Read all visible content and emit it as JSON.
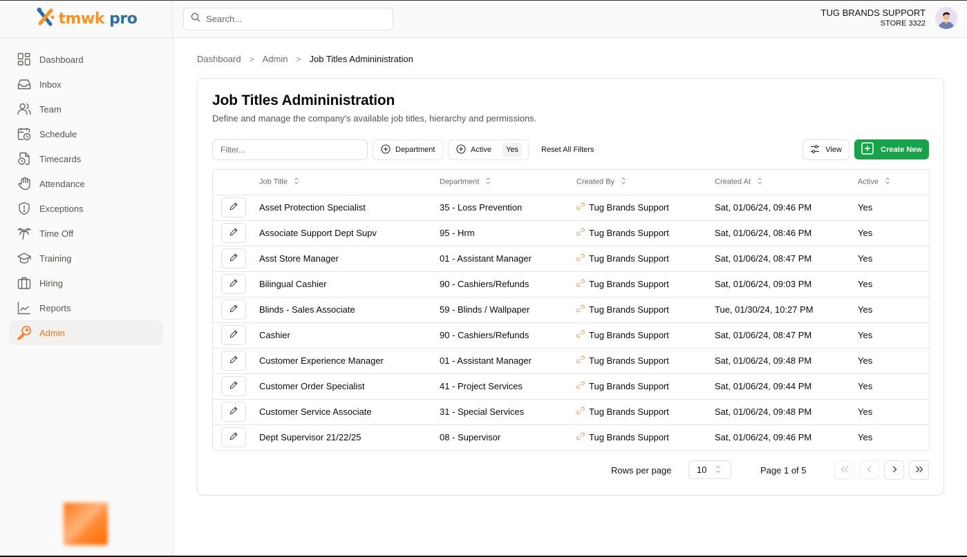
{
  "app": {
    "logo_prefix": "tmwk",
    "logo_suffix": "pro"
  },
  "header": {
    "search_placeholder": "Search...",
    "user_name": "TUG BRANDS SUPPORT",
    "user_store": "STORE 3322"
  },
  "sidebar": {
    "items": [
      {
        "label": "Dashboard",
        "icon": "dashboard-icon"
      },
      {
        "label": "Inbox",
        "icon": "inbox-icon"
      },
      {
        "label": "Team",
        "icon": "team-icon"
      },
      {
        "label": "Schedule",
        "icon": "schedule-icon"
      },
      {
        "label": "Timecards",
        "icon": "timecards-icon"
      },
      {
        "label": "Attendance",
        "icon": "attendance-icon"
      },
      {
        "label": "Exceptions",
        "icon": "exceptions-icon"
      },
      {
        "label": "Time Off",
        "icon": "time-off-icon"
      },
      {
        "label": "Training",
        "icon": "training-icon"
      },
      {
        "label": "Hiring",
        "icon": "hiring-icon"
      },
      {
        "label": "Reports",
        "icon": "reports-icon"
      },
      {
        "label": "Admin",
        "icon": "admin-key-icon",
        "active": true
      }
    ]
  },
  "breadcrumb": {
    "items": [
      "Dashboard",
      "Admin"
    ],
    "current": "Job Titles Admininistration"
  },
  "page": {
    "title": "Job Titles Admininistration",
    "subtitle": "Define and manage the company's available job titles, hierarchy and permissions."
  },
  "toolbar": {
    "filter_placeholder": "Filter...",
    "department_chip": "Department",
    "active_chip": "Active",
    "active_value": "Yes",
    "reset_label": "Reset All Filters",
    "view_label": "View",
    "create_label": "Create New"
  },
  "colors": {
    "accent": "#f97316",
    "primary_button": "#16a34a",
    "link_icon": "#f59e5b"
  },
  "table": {
    "columns": [
      "Job Title",
      "Department",
      "Created By",
      "Created At",
      "Active"
    ],
    "rows": [
      {
        "job_title": "Asset Protection Specialist",
        "department": "35 - Loss Prevention",
        "created_by": "Tug Brands Support",
        "created_at": "Sat, 01/06/24, 09:46 PM",
        "active": "Yes"
      },
      {
        "job_title": "Associate Support Dept Supv",
        "department": "95 - Hrm",
        "created_by": "Tug Brands Support",
        "created_at": "Sat, 01/06/24, 08:46 PM",
        "active": "Yes"
      },
      {
        "job_title": "Asst Store Manager",
        "department": "01 - Assistant Manager",
        "created_by": "Tug Brands Support",
        "created_at": "Sat, 01/06/24, 08:47 PM",
        "active": "Yes"
      },
      {
        "job_title": "Bilingual Cashier",
        "department": "90 - Cashiers/Refunds",
        "created_by": "Tug Brands Support",
        "created_at": "Sat, 01/06/24, 09:03 PM",
        "active": "Yes"
      },
      {
        "job_title": "Blinds - Sales Associate",
        "department": "59 - Blinds / Wallpaper",
        "created_by": "Tug Brands Support",
        "created_at": "Tue, 01/30/24, 10:27 PM",
        "active": "Yes"
      },
      {
        "job_title": "Cashier",
        "department": "90 - Cashiers/Refunds",
        "created_by": "Tug Brands Support",
        "created_at": "Sat, 01/06/24, 08:47 PM",
        "active": "Yes"
      },
      {
        "job_title": "Customer Experience Manager",
        "department": "01 - Assistant Manager",
        "created_by": "Tug Brands Support",
        "created_at": "Sat, 01/06/24, 09:48 PM",
        "active": "Yes"
      },
      {
        "job_title": "Customer Order Specialist",
        "department": "41 - Project Services",
        "created_by": "Tug Brands Support",
        "created_at": "Sat, 01/06/24, 09:44 PM",
        "active": "Yes"
      },
      {
        "job_title": "Customer Service Associate",
        "department": "31 - Special Services",
        "created_by": "Tug Brands Support",
        "created_at": "Sat, 01/06/24, 09:48 PM",
        "active": "Yes"
      },
      {
        "job_title": "Dept Supervisor 21/22/25",
        "department": "08 - Supervisor",
        "created_by": "Tug Brands Support",
        "created_at": "Sat, 01/06/24, 09:46 PM",
        "active": "Yes"
      }
    ]
  },
  "pagination": {
    "rows_per_page_label": "Rows per page",
    "rows_per_page_value": "10",
    "page_info": "Page 1 of 5",
    "current_page": 1,
    "total_pages": 5
  }
}
